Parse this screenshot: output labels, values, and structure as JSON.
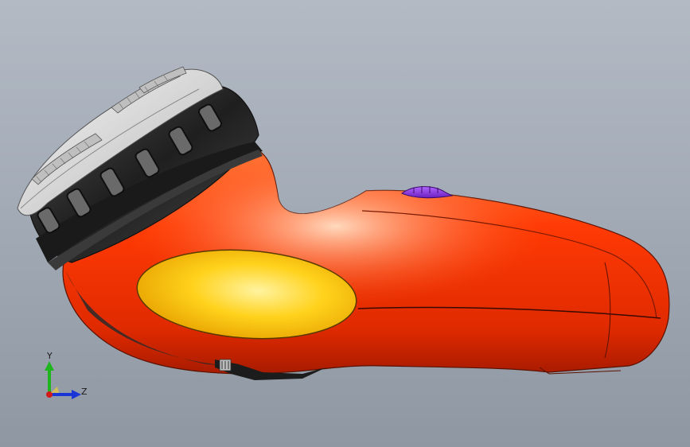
{
  "viewport": {
    "background_top": "#b3bac4",
    "background_bottom": "#8f97a3"
  },
  "model": {
    "body_color": "#ff3a05",
    "panel_color": "#ffd21c",
    "button_color": "#8a2be2",
    "head_ring_color": "#2a2a2a",
    "foil_color": "#d9d9d9"
  },
  "triad": {
    "y_label": "Y",
    "z_label": "Z",
    "y_color": "#1fb51f",
    "z_color": "#1a36d6",
    "x_color": "#d11a1a"
  }
}
